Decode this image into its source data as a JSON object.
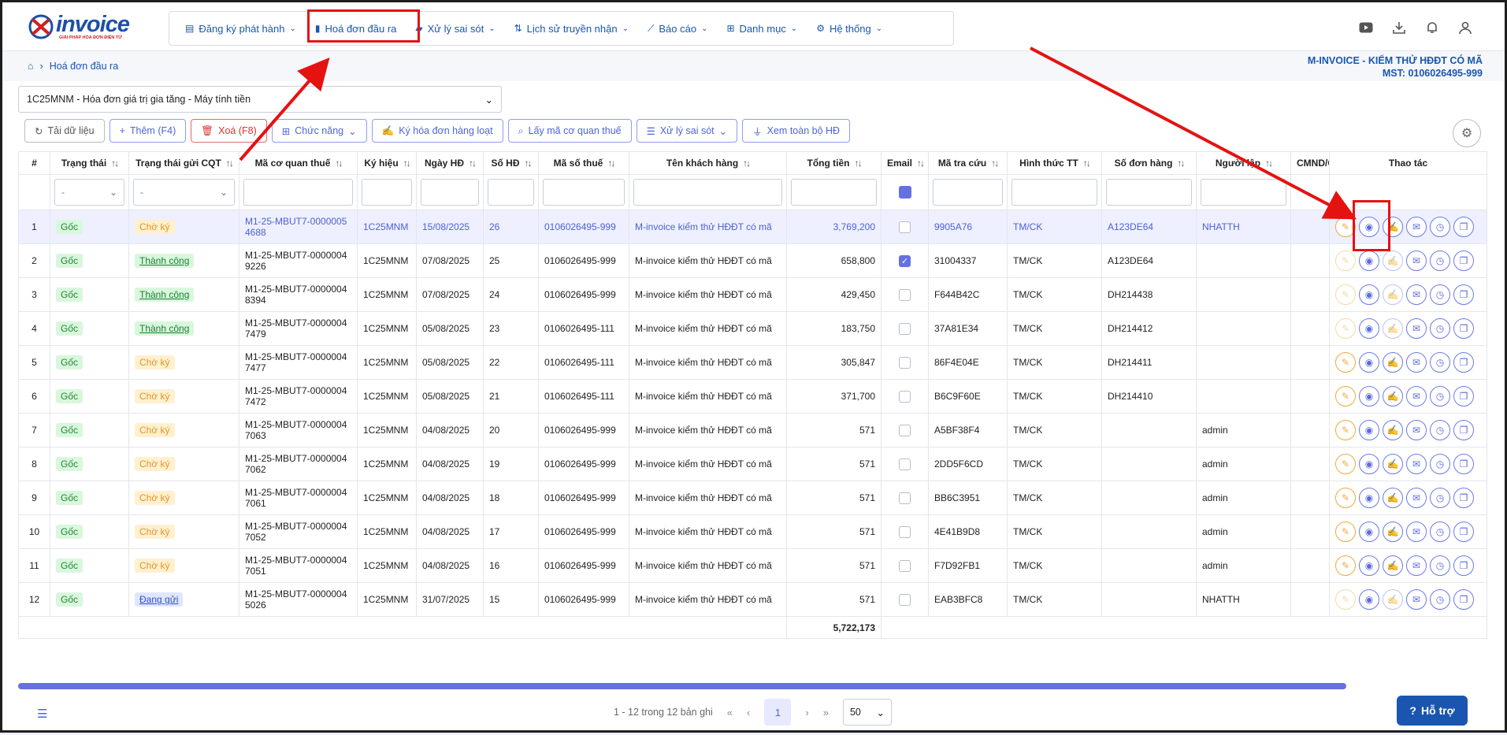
{
  "logo": {
    "name": "invoice",
    "tagline": "GIẢI PHÁP HÓA ĐƠN ĐIỆN TỬ"
  },
  "nav": [
    {
      "label": "Đăng ký phát hành",
      "icon": "document-icon",
      "dropdown": true
    },
    {
      "label": "Hoá đơn đầu ra",
      "icon": "invoice-icon",
      "dropdown": false
    },
    {
      "label": "Xử lý sai sót",
      "icon": "error-file-icon",
      "dropdown": true
    },
    {
      "label": "Lịch sử truyền nhận",
      "icon": "transfer-icon",
      "dropdown": true
    },
    {
      "label": "Báo cáo",
      "icon": "chart-icon",
      "dropdown": true
    },
    {
      "label": "Danh mục",
      "icon": "grid-icon",
      "dropdown": true
    },
    {
      "label": "Hệ thống",
      "icon": "gear-icon",
      "dropdown": true
    }
  ],
  "breadcrumb": {
    "current": "Hoá đơn đầu ra"
  },
  "company": {
    "name": "M-INVOICE - KIỂM THỬ HĐĐT CÓ MÃ",
    "tax": "MST: 0106026495-999"
  },
  "series": {
    "value": "1C25MNM - Hóa đơn giá trị gia tăng - Máy tính tiền"
  },
  "toolbar": {
    "reload": "Tải dữ liệu",
    "add": "Thêm (F4)",
    "delete": "Xoá (F8)",
    "functions": "Chức năng",
    "sign_batch": "Ký hóa đơn hàng loạt",
    "get_tax_code": "Lấy mã cơ quan thuế",
    "handle_error": "Xử lý sai sót",
    "view_all": "Xem toàn bộ HĐ"
  },
  "columns": [
    "#",
    "Trạng thái",
    "Trạng thái gửi CQT",
    "Mã cơ quan thuế",
    "Ký hiệu",
    "Ngày HĐ",
    "Số HĐ",
    "Mã số thuế",
    "Tên khách hàng",
    "Tổng tiền",
    "Email",
    "Mã tra cứu",
    "Hình thức TT",
    "Số đơn hàng",
    "Người lập",
    "CMND/C",
    "Thao tác"
  ],
  "filters": {
    "status": "-",
    "cqt_status": "-"
  },
  "rows": [
    {
      "no": "1",
      "status": "Gốc",
      "cqt": "Chờ ký",
      "cqt_type": "cho",
      "code": "M1-25-MBUT7-00000054688",
      "symbol": "1C25MNM",
      "date": "15/08/2025",
      "num": "26",
      "tax": "0106026495-999",
      "customer": "M-invoice kiểm thử HĐĐT có mã",
      "total": "3,769,200",
      "email": false,
      "lookup": "9905A76",
      "pay": "TM/CK",
      "order": "A123DE64",
      "creator": "NHATTH",
      "selected": true,
      "sign_faded": false
    },
    {
      "no": "2",
      "status": "Gốc",
      "cqt": "Thành công",
      "cqt_type": "tc",
      "code": "M1-25-MBUT7-00000049226",
      "symbol": "1C25MNM",
      "date": "07/08/2025",
      "num": "25",
      "tax": "0106026495-999",
      "customer": "M-invoice kiểm thử HĐĐT có mã",
      "total": "658,800",
      "email": true,
      "lookup": "31004337",
      "pay": "TM/CK",
      "order": "A123DE64",
      "creator": "",
      "selected": false,
      "sign_faded": true
    },
    {
      "no": "3",
      "status": "Gốc",
      "cqt": "Thành công",
      "cqt_type": "tc",
      "code": "M1-25-MBUT7-00000048394",
      "symbol": "1C25MNM",
      "date": "07/08/2025",
      "num": "24",
      "tax": "0106026495-999",
      "customer": "M-invoice kiểm thử HĐĐT có mã",
      "total": "429,450",
      "email": false,
      "lookup": "F644B42C",
      "pay": "TM/CK",
      "order": "DH214438",
      "creator": "",
      "selected": false,
      "sign_faded": true
    },
    {
      "no": "4",
      "status": "Gốc",
      "cqt": "Thành công",
      "cqt_type": "tc",
      "code": "M1-25-MBUT7-00000047479",
      "symbol": "1C25MNM",
      "date": "05/08/2025",
      "num": "23",
      "tax": "0106026495-111",
      "customer": "M-invoice kiểm thử HĐĐT có mã",
      "total": "183,750",
      "email": false,
      "lookup": "37A81E34",
      "pay": "TM/CK",
      "order": "DH214412",
      "creator": "",
      "selected": false,
      "sign_faded": true
    },
    {
      "no": "5",
      "status": "Gốc",
      "cqt": "Chờ ký",
      "cqt_type": "cho",
      "code": "M1-25-MBUT7-00000047477",
      "symbol": "1C25MNM",
      "date": "05/08/2025",
      "num": "22",
      "tax": "0106026495-111",
      "customer": "M-invoice kiểm thử HĐĐT có mã",
      "total": "305,847",
      "email": false,
      "lookup": "86F4E04E",
      "pay": "TM/CK",
      "order": "DH214411",
      "creator": "",
      "selected": false,
      "sign_faded": false
    },
    {
      "no": "6",
      "status": "Gốc",
      "cqt": "Chờ ký",
      "cqt_type": "cho",
      "code": "M1-25-MBUT7-00000047472",
      "symbol": "1C25MNM",
      "date": "05/08/2025",
      "num": "21",
      "tax": "0106026495-111",
      "customer": "M-invoice kiểm thử HĐĐT có mã",
      "total": "371,700",
      "email": false,
      "lookup": "B6C9F60E",
      "pay": "TM/CK",
      "order": "DH214410",
      "creator": "",
      "selected": false,
      "sign_faded": false
    },
    {
      "no": "7",
      "status": "Gốc",
      "cqt": "Chờ ký",
      "cqt_type": "cho",
      "code": "M1-25-MBUT7-00000047063",
      "symbol": "1C25MNM",
      "date": "04/08/2025",
      "num": "20",
      "tax": "0106026495-999",
      "customer": "M-invoice kiểm thử HĐĐT có mã",
      "total": "571",
      "email": false,
      "lookup": "A5BF38F4",
      "pay": "TM/CK",
      "order": "",
      "creator": "admin",
      "selected": false,
      "sign_faded": false
    },
    {
      "no": "8",
      "status": "Gốc",
      "cqt": "Chờ ký",
      "cqt_type": "cho",
      "code": "M1-25-MBUT7-00000047062",
      "symbol": "1C25MNM",
      "date": "04/08/2025",
      "num": "19",
      "tax": "0106026495-999",
      "customer": "M-invoice kiểm thử HĐĐT có mã",
      "total": "571",
      "email": false,
      "lookup": "2DD5F6CD",
      "pay": "TM/CK",
      "order": "",
      "creator": "admin",
      "selected": false,
      "sign_faded": false
    },
    {
      "no": "9",
      "status": "Gốc",
      "cqt": "Chờ ký",
      "cqt_type": "cho",
      "code": "M1-25-MBUT7-00000047061",
      "symbol": "1C25MNM",
      "date": "04/08/2025",
      "num": "18",
      "tax": "0106026495-999",
      "customer": "M-invoice kiểm thử HĐĐT có mã",
      "total": "571",
      "email": false,
      "lookup": "BB6C3951",
      "pay": "TM/CK",
      "order": "",
      "creator": "admin",
      "selected": false,
      "sign_faded": false
    },
    {
      "no": "10",
      "status": "Gốc",
      "cqt": "Chờ ký",
      "cqt_type": "cho",
      "code": "M1-25-MBUT7-00000047052",
      "symbol": "1C25MNM",
      "date": "04/08/2025",
      "num": "17",
      "tax": "0106026495-999",
      "customer": "M-invoice kiểm thử HĐĐT có mã",
      "total": "571",
      "email": false,
      "lookup": "4E41B9D8",
      "pay": "TM/CK",
      "order": "",
      "creator": "admin",
      "selected": false,
      "sign_faded": false
    },
    {
      "no": "11",
      "status": "Gốc",
      "cqt": "Chờ ký",
      "cqt_type": "cho",
      "code": "M1-25-MBUT7-00000047051",
      "symbol": "1C25MNM",
      "date": "04/08/2025",
      "num": "16",
      "tax": "0106026495-999",
      "customer": "M-invoice kiểm thử HĐĐT có mã",
      "total": "571",
      "email": false,
      "lookup": "F7D92FB1",
      "pay": "TM/CK",
      "order": "",
      "creator": "admin",
      "selected": false,
      "sign_faded": false
    },
    {
      "no": "12",
      "status": "Gốc",
      "cqt": "Đang gửi",
      "cqt_type": "dg",
      "code": "M1-25-MBUT7-00000045026",
      "symbol": "1C25MNM",
      "date": "31/07/2025",
      "num": "15",
      "tax": "0106026495-999",
      "customer": "M-invoice kiểm thử HĐĐT có mã",
      "total": "571",
      "email": false,
      "lookup": "EAB3BFC8",
      "pay": "TM/CK",
      "order": "",
      "creator": "NHATTH",
      "selected": false,
      "sign_faded": true
    }
  ],
  "total_sum": "5,722,173",
  "pagination": {
    "summary": "1 - 12 trong 12 bản ghi",
    "current": "1",
    "page_size": "50"
  },
  "help": {
    "label": "Hỗ trợ"
  },
  "colors": {
    "brand": "#1a56b0",
    "accent": "#6571e0",
    "annotation": "#e51212"
  }
}
